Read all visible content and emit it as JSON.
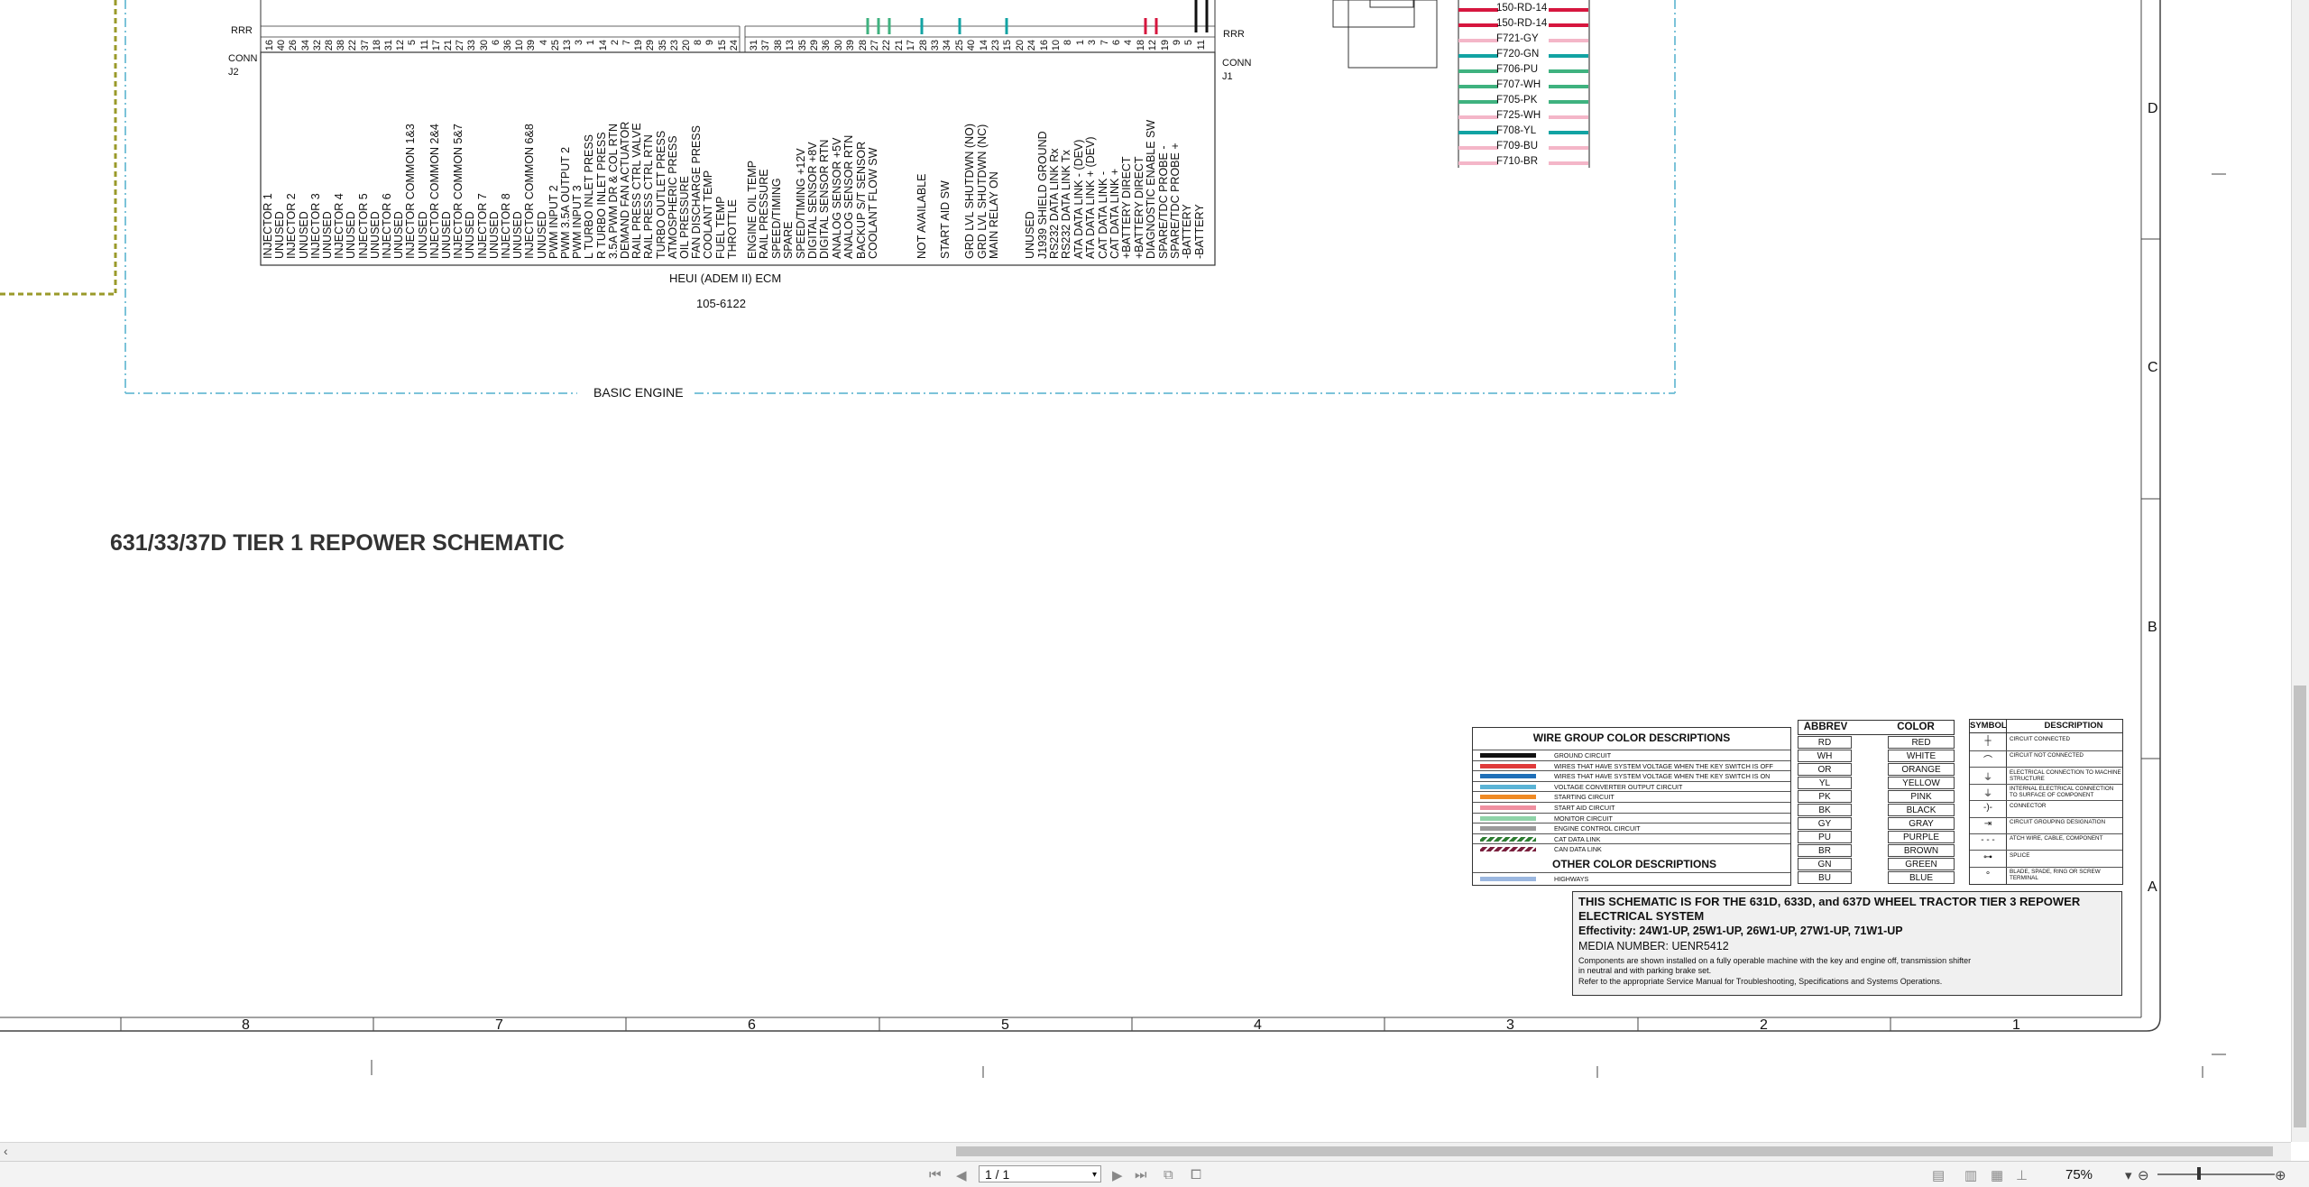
{
  "schematic": {
    "title": "631/33/37D TIER 1 REPOWER SCHEMATIC",
    "ecm_name": "HEUI (ADEM II) ECM",
    "ecm_part": "105-6122",
    "group_label": "BASIC ENGINE",
    "conn_j2": {
      "label": "CONN",
      "id": "J2",
      "rrr": "RRR"
    },
    "conn_j1": {
      "label": "CONN",
      "id": "J1",
      "rrr": "RRR"
    },
    "j2_pins": [
      "16",
      "40",
      "26",
      "34",
      "32",
      "28",
      "38",
      "22",
      "37",
      "18",
      "31",
      "12",
      "5",
      "11",
      "17",
      "21",
      "27",
      "33",
      "30",
      "6",
      "36",
      "10",
      "39",
      "4",
      "25",
      "13",
      "3",
      "1",
      "14",
      "2",
      "7",
      "19",
      "29",
      "35",
      "23",
      "20",
      "8",
      "9",
      "15",
      "24"
    ],
    "j2_functions": [
      "INJECTOR 1",
      "UNUSED",
      "INJECTOR 2",
      "UNUSED",
      "INJECTOR 3",
      "UNUSED",
      "INJECTOR 4",
      "UNUSED",
      "INJECTOR 5",
      "UNUSED",
      "INJECTOR 6",
      "UNUSED",
      "INJECTOR COMMON 1&3",
      "UNUSED",
      "INJECTOR COMMON 2&4",
      "UNUSED",
      "INJECTOR COMMON 5&7",
      "UNUSED",
      "INJECTOR 7",
      "UNUSED",
      "INJECTOR 8",
      "UNUSED",
      "INJECTOR COMMON 6&8",
      "UNUSED",
      "PWM INPUT 2",
      "PWM 3.5A OUTPUT 2",
      "PWM INPUT 3",
      "L TURBO INLET PRESS",
      "R TURBO INLET PRESS",
      "3.5A PWM DR & COL RTN",
      "DEMAND FAN ACTUATOR",
      "RAIL PRESS CTRL VALVE",
      "RAIL PRESS CTRL RTN",
      "TURBO OUTLET PRESS",
      "ATMOSPHERIC PRESS",
      "OIL PRESSURE",
      "FAN DISCHARGE PRESS",
      "COOLANT TEMP",
      "FUEL TEMP",
      "THROTTLE"
    ],
    "j1_pins": [
      "31",
      "37",
      "38",
      "13",
      "35",
      "29",
      "36",
      "30",
      "39",
      "28",
      "27",
      "22",
      "21",
      "17",
      "28",
      "33",
      "34",
      "25",
      "40",
      "14",
      "23",
      "15",
      "20",
      "24",
      "16",
      "10",
      "8",
      "1",
      "3",
      "7",
      "6",
      "4",
      "18",
      "12",
      "19",
      "9",
      "5",
      "11"
    ],
    "j1_functions": [
      "ENGINE OIL TEMP",
      "RAIL PRESSURE",
      "SPEED/TIMING",
      "SPARE",
      "SPEED/TIMING +12V",
      "DIGITAL SENSOR +8V",
      "DIGITAL SENSOR RTN",
      "ANALOG SENSOR +5V",
      "ANALOG SENSOR RTN",
      "BACKUP S/T SENSOR",
      "COOLANT FLOW SW",
      "",
      "",
      "",
      "NOT AVAILABLE",
      "",
      "START AID SW",
      "",
      "GRD LVL SHUTDWN (NO)",
      "GRD LVL SHUTDWN (NC)",
      "MAIN RELAY ON",
      "",
      "",
      "UNUSED",
      "J1939 SHIELD GROUND",
      "RS232 DATA LINK Rx",
      "RS232 DATA LINK Tx",
      "ATA DATA LINK - (DEV)",
      "ATA DATA LINK + (DEV)",
      "CAT DATA LINK -",
      "CAT DATA LINK +",
      "+BATTERY DIRECT",
      "+BATTERY DIRECT",
      "DIAGNOSTIC ENABLE SW",
      "SPARE/TDC PROBE -",
      "SPARE/TDC PROBE +",
      "-BATTERY",
      "-BATTERY"
    ],
    "wire_labels": [
      {
        "text": "150-RD-14",
        "color": "#d6163e"
      },
      {
        "text": "150-RD-14",
        "color": "#d6163e"
      },
      {
        "text": "F721-GY",
        "color": "#f4b6c8"
      },
      {
        "text": "F720-GN",
        "color": "#12a3a3"
      },
      {
        "text": "F706-PU",
        "color": "#3fb27f"
      },
      {
        "text": "F707-WH",
        "color": "#3fb27f"
      },
      {
        "text": "F705-PK",
        "color": "#3fb27f"
      },
      {
        "text": "F725-WH",
        "color": "#f4b6c8"
      },
      {
        "text": "F708-YL",
        "color": "#12a3a3"
      },
      {
        "text": "F709-BU",
        "color": "#f4b6c8"
      },
      {
        "text": "F710-BR",
        "color": "#f4b6c8"
      }
    ]
  },
  "legend": {
    "wire_group_title": "WIRE GROUP COLOR DESCRIPTIONS",
    "wire_groups": [
      {
        "label": "GROUND CIRCUIT",
        "color": "#111111"
      },
      {
        "label": "WIRES THAT HAVE SYSTEM VOLTAGE WHEN THE KEY SWITCH IS OFF",
        "color": "#e03b3b"
      },
      {
        "label": "WIRES THAT HAVE SYSTEM VOLTAGE WHEN THE KEY SWITCH IS ON",
        "color": "#1f6fb8"
      },
      {
        "label": "VOLTAGE CONVERTER OUTPUT CIRCUIT",
        "color": "#5bb4d6"
      },
      {
        "label": "STARTING CIRCUIT",
        "color": "#f08a24"
      },
      {
        "label": "START AID CIRCUIT",
        "color": "#f08fa0"
      },
      {
        "label": "MONITOR CIRCUIT",
        "color": "#8fd3a8"
      },
      {
        "label": "ENGINE CONTROL CIRCUIT",
        "color": "#9a9a9a"
      },
      {
        "label": "CAT DATA LINK",
        "color": "#2e7d32"
      },
      {
        "label": "CAN DATA LINK",
        "color": "#7a1f3d"
      }
    ],
    "other_title": "OTHER COLOR DESCRIPTIONS",
    "other_groups": [
      {
        "label": "HIGHWAYS",
        "color": "#9bb7e0"
      }
    ],
    "abbrev_header": "ABBREV",
    "color_header": "COLOR",
    "colors": [
      [
        "RD",
        "RED"
      ],
      [
        "WH",
        "WHITE"
      ],
      [
        "OR",
        "ORANGE"
      ],
      [
        "YL",
        "YELLOW"
      ],
      [
        "PK",
        "PINK"
      ],
      [
        "BK",
        "BLACK"
      ],
      [
        "GY",
        "GRAY"
      ],
      [
        "PU",
        "PURPLE"
      ],
      [
        "BR",
        "BROWN"
      ],
      [
        "GN",
        "GREEN"
      ],
      [
        "BU",
        "BLUE"
      ]
    ],
    "symbol_header": "SYMBOL",
    "description_header": "DESCRIPTION",
    "symbols": [
      {
        "glyph": "┼",
        "label": "CIRCUIT CONNECTED"
      },
      {
        "glyph": "⌒",
        "label": "CIRCUIT NOT CONNECTED"
      },
      {
        "glyph": "⏚",
        "label": "ELECTRICAL CONNECTION TO MACHINE STRUCTURE"
      },
      {
        "glyph": "⏚",
        "label": "INTERNAL ELECTRICAL CONNECTION TO SURFACE OF COMPONENT"
      },
      {
        "glyph": "-)-",
        "label": "CONNECTOR"
      },
      {
        "glyph": "⇥",
        "label": "CIRCUIT GROUPING DESIGNATION"
      },
      {
        "glyph": "- - -",
        "label": "ATCH WIRE, CABLE, COMPONENT"
      },
      {
        "glyph": "⊶",
        "label": "SPLICE"
      },
      {
        "glyph": "∘",
        "label": "BLADE, SPADE, RING OR SCREW TERMINAL"
      }
    ]
  },
  "title_block": {
    "line1": "THIS SCHEMATIC IS FOR THE 631D, 633D, and 637D WHEEL TRACTOR TIER 3 REPOWER ELECTRICAL SYSTEM",
    "effectivity": "Effectivity: 24W1-UP, 25W1-UP, 26W1-UP, 27W1-UP, 71W1-UP",
    "media": "MEDIA NUMBER: UENR5412",
    "note1": "Components are shown installed on a fully operable machine with the key and engine off, transmission shifter",
    "note2": "in neutral and with parking brake set.",
    "note3": "Refer to the appropriate Service Manual for Troubleshooting, Specifications and Systems Operations."
  },
  "grid": {
    "columns": [
      "8",
      "7",
      "6",
      "5",
      "4",
      "3",
      "2",
      "1"
    ],
    "rows": [
      "D",
      "C",
      "B",
      "A"
    ]
  },
  "statusbar": {
    "page": "1 / 1",
    "zoom": "75%"
  }
}
